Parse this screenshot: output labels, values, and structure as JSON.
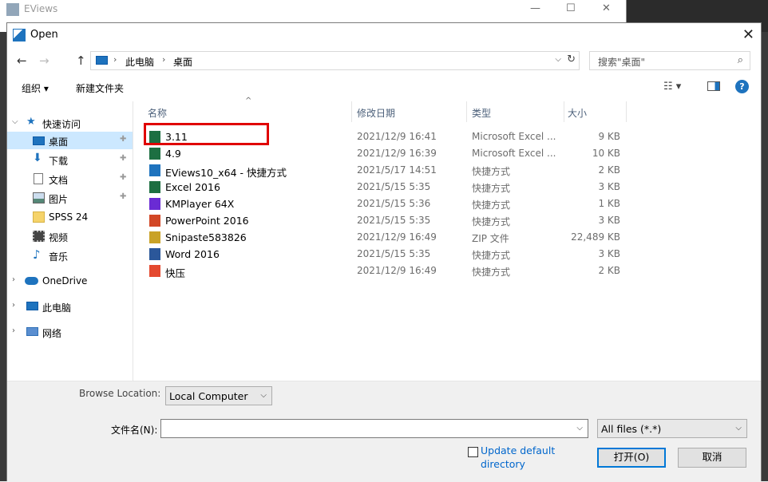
{
  "background_window": {
    "title": "EViews",
    "min": "—",
    "max": "☐",
    "close": "✕"
  },
  "dialog": {
    "title": "Open",
    "close_glyph": "✕"
  },
  "nav": {
    "back": "←",
    "forward": "→",
    "up": "↑",
    "breadcrumb": [
      "此电脑",
      "桌面"
    ],
    "sep": "›",
    "dropdown": "⌵",
    "refresh": "↻",
    "search_placeholder": "搜索\"桌面\"",
    "search_icon": "⌕"
  },
  "toolbar": {
    "organize": "组织 ▾",
    "new_folder": "新建文件夹",
    "view_icon": "☷ ▾",
    "help": "?"
  },
  "sidebar": {
    "items": [
      {
        "label": "快速访问",
        "icon": "star-icon",
        "expander": "⌵",
        "pinned": false
      },
      {
        "label": "桌面",
        "icon": "desktop-icon",
        "pinned": true,
        "selected": true
      },
      {
        "label": "下载",
        "icon": "download-icon",
        "pinned": true
      },
      {
        "label": "文档",
        "icon": "document-icon",
        "pinned": true
      },
      {
        "label": "图片",
        "icon": "picture-icon",
        "pinned": true
      },
      {
        "label": "SPSS 24",
        "icon": "folder-icon"
      },
      {
        "label": "视频",
        "icon": "video-icon"
      },
      {
        "label": "音乐",
        "icon": "music-icon"
      },
      {
        "label": "OneDrive",
        "icon": "cloud-icon",
        "expander": "›"
      },
      {
        "label": "此电脑",
        "icon": "computer-icon",
        "expander": "›"
      },
      {
        "label": "网络",
        "icon": "network-icon",
        "expander": "›"
      }
    ],
    "pin_glyph": "📌"
  },
  "columns": {
    "name": "名称",
    "date": "修改日期",
    "type": "类型",
    "size": "大小",
    "sort_glyph": "^"
  },
  "files": [
    {
      "name": "3.11",
      "date": "2021/12/9 16:41",
      "type": "Microsoft Excel ...",
      "size": "9 KB",
      "icon": "excel-file-icon",
      "color": "#1d6f42"
    },
    {
      "name": "4.9",
      "date": "2021/12/9 16:39",
      "type": "Microsoft Excel ...",
      "size": "10 KB",
      "icon": "excel-file-icon",
      "color": "#1d6f42"
    },
    {
      "name": "EViews10_x64 - 快捷方式",
      "date": "2021/5/17 14:51",
      "type": "快捷方式",
      "size": "2 KB",
      "icon": "eviews-shortcut-icon",
      "color": "#1e73be"
    },
    {
      "name": "Excel 2016",
      "date": "2021/5/15 5:35",
      "type": "快捷方式",
      "size": "3 KB",
      "icon": "excel-shortcut-icon",
      "color": "#1d6f42"
    },
    {
      "name": "KMPlayer 64X",
      "date": "2021/5/15 5:36",
      "type": "快捷方式",
      "size": "1 KB",
      "icon": "kmplayer-shortcut-icon",
      "color": "#6a2bd4"
    },
    {
      "name": "PowerPoint 2016",
      "date": "2021/5/15 5:35",
      "type": "快捷方式",
      "size": "3 KB",
      "icon": "powerpoint-shortcut-icon",
      "color": "#d24726"
    },
    {
      "name": "Snipaste583826",
      "date": "2021/12/9 16:49",
      "type": "ZIP 文件",
      "size": "22,489 KB",
      "icon": "zip-file-icon",
      "color": "#c9a227"
    },
    {
      "name": "Word 2016",
      "date": "2021/5/15 5:35",
      "type": "快捷方式",
      "size": "3 KB",
      "icon": "word-shortcut-icon",
      "color": "#2b579a"
    },
    {
      "name": "快压",
      "date": "2021/12/9 16:49",
      "type": "快捷方式",
      "size": "2 KB",
      "icon": "kuaiya-shortcut-icon",
      "color": "#e4492f"
    }
  ],
  "bottom": {
    "browse_location_label": "Browse Location:",
    "browse_location_value": "Local Computer",
    "filename_label": "文件名(N):",
    "filename_value": "",
    "filter_value": "All files (*.*)",
    "update_default_line1": "Update default",
    "update_default_line2": "directory",
    "open_button": "打开(O)",
    "cancel_button": "取消",
    "arrow": "⌵"
  }
}
